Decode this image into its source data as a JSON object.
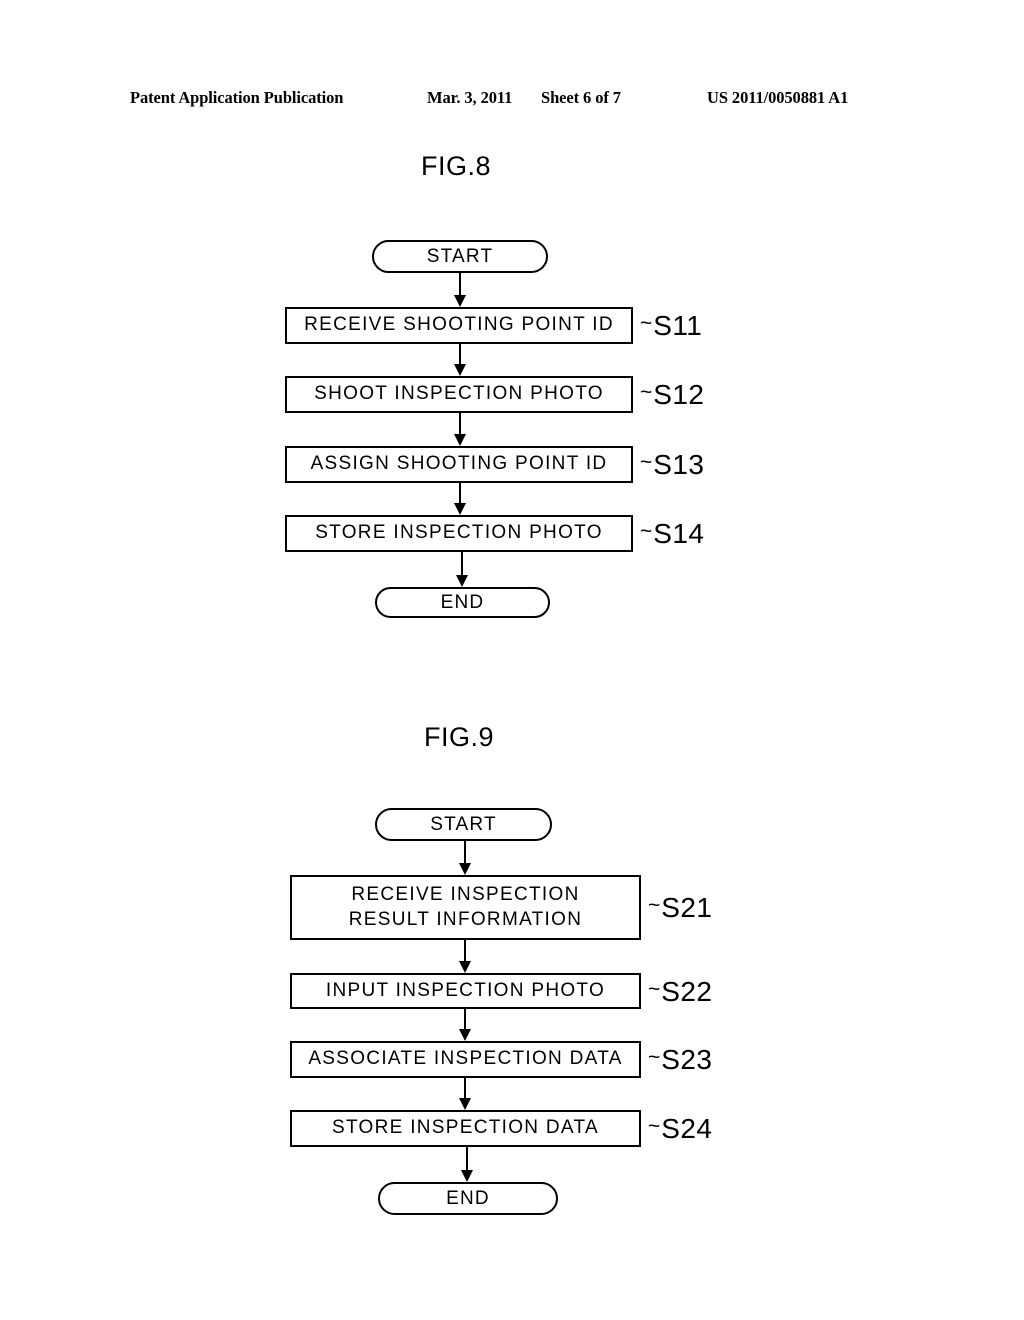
{
  "header": {
    "publication": "Patent Application Publication",
    "date": "Mar. 3, 2011",
    "sheet": "Sheet 6 of 7",
    "document_number": "US 2011/0050881 A1"
  },
  "figures": [
    {
      "title": "FIG.8",
      "start_label": "START",
      "end_label": "END",
      "steps": [
        {
          "text": "RECEIVE SHOOTING POINT ID",
          "ref": "S11",
          "tilde": "~"
        },
        {
          "text": "SHOOT INSPECTION PHOTO",
          "ref": "S12",
          "tilde": "~"
        },
        {
          "text": "ASSIGN SHOOTING POINT ID",
          "ref": "S13",
          "tilde": "~"
        },
        {
          "text": "STORE INSPECTION PHOTO",
          "ref": "S14",
          "tilde": "~"
        }
      ]
    },
    {
      "title": "FIG.9",
      "start_label": "START",
      "end_label": "END",
      "steps": [
        {
          "text": "RECEIVE INSPECTION\nRESULT INFORMATION",
          "ref": "S21",
          "tilde": "~"
        },
        {
          "text": "INPUT INSPECTION PHOTO",
          "ref": "S22",
          "tilde": "~"
        },
        {
          "text": "ASSOCIATE INSPECTION DATA",
          "ref": "S23",
          "tilde": "~"
        },
        {
          "text": "STORE INSPECTION DATA",
          "ref": "S24",
          "tilde": "~"
        }
      ]
    }
  ],
  "colors": {
    "ink": "#000000",
    "page": "#ffffff"
  }
}
